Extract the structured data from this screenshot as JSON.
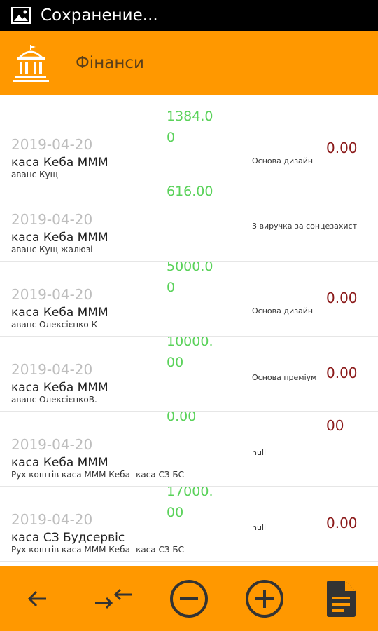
{
  "status_bar": {
    "title": "Сохранение...",
    "icon": "image-icon"
  },
  "app_bar": {
    "title": "Фінанси",
    "logo_icon": "bank-building-icon"
  },
  "colors": {
    "accent": "#ff9800",
    "amount": "#5ad25a",
    "balance": "#8b1a1a",
    "date": "#bdbdbd"
  },
  "transactions": [
    {
      "date": "2019-04-20",
      "kasa": "каса Кеба МММ",
      "description": "аванс Кущ",
      "amount": "1384.00",
      "category": "Основа дизайн",
      "balance": "0.00"
    },
    {
      "date": "2019-04-20",
      "kasa": "каса Кеба МММ",
      "description": "аванс Кущ жалюзі",
      "amount": "616.00",
      "category": "3 виручка за сонцезахист",
      "balance": ""
    },
    {
      "date": "2019-04-20",
      "kasa": "каса Кеба МММ",
      "description": "аванс Олексієнко К",
      "amount": "5000.00",
      "category": "Основа дизайн",
      "balance": "0.00"
    },
    {
      "date": "2019-04-20",
      "kasa": "каса Кеба МММ",
      "description": "аванс ОлексієнкоВ.",
      "amount": "10000.00",
      "category": "Основа преміум",
      "balance": "0.00"
    },
    {
      "date": "2019-04-20",
      "kasa": "каса Кеба МММ",
      "description": "Рух коштів каса МММ Кеба- каса СЗ БС",
      "amount": "0.00",
      "category": "null",
      "balance": "00"
    },
    {
      "date": "2019-04-20",
      "kasa": "каса СЗ Будсервіс",
      "description": "Рух коштів каса МММ Кеба- каса СЗ БС",
      "amount": "17000.00",
      "category": "null",
      "balance": "0.00"
    }
  ],
  "bottom_bar": {
    "buttons": [
      {
        "name": "back-button",
        "icon": "arrow-left-icon"
      },
      {
        "name": "transfer-button",
        "icon": "transfer-arrows-icon"
      },
      {
        "name": "expense-button",
        "icon": "minus-circle-icon"
      },
      {
        "name": "income-button",
        "icon": "plus-circle-icon"
      },
      {
        "name": "report-button",
        "icon": "document-icon"
      }
    ]
  }
}
